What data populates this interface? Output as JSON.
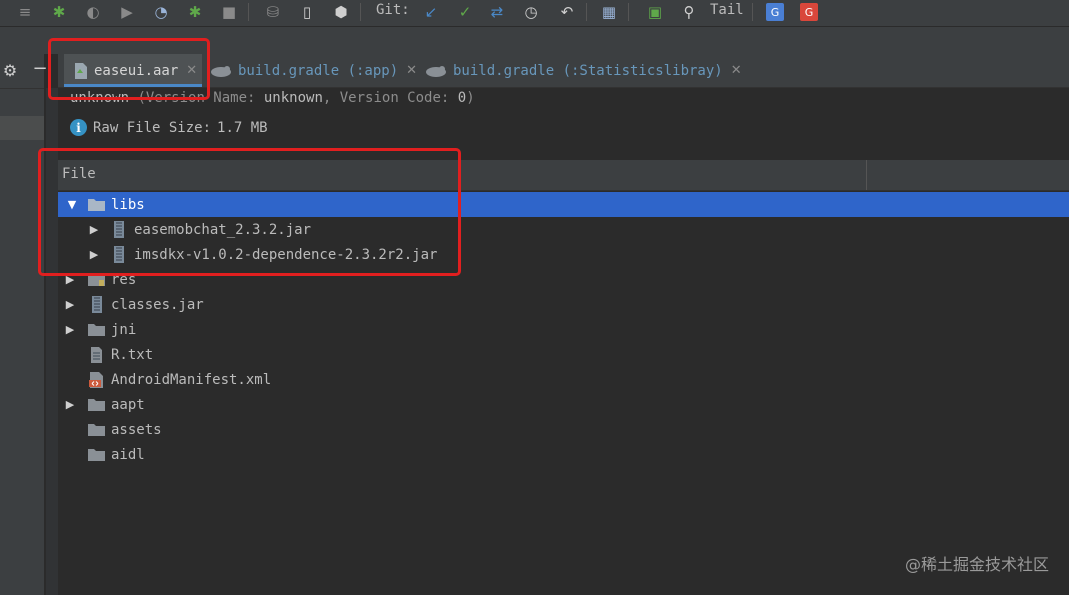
{
  "toolbar": {
    "git_label": "Git:",
    "tail_label": "Tail",
    "icons": [
      "settings-icon",
      "debug-icon",
      "profile-icon",
      "run-icon",
      "gauge-icon",
      "debug-attach-icon",
      "stop-icon",
      "gradle-icon",
      "device-icon",
      "sdk-icon",
      "update-icon",
      "commit-icon",
      "push-icon",
      "history-icon",
      "revert-icon",
      "structure-icon",
      "terminal-icon",
      "search-icon",
      "translate-icon",
      "translate-alt-icon"
    ]
  },
  "tabs": [
    {
      "label": "easeui.aar",
      "active": true
    },
    {
      "label": "build.gradle (:app)",
      "active": false
    },
    {
      "label": "build.gradle (:Statisticslibray)",
      "active": false
    }
  ],
  "info": {
    "version_line_start": "unknown",
    "version_line_dim": " (Version Name: ",
    "version_name": "unknown",
    "version_code_label": ", Version Code: ",
    "version_code": "0",
    "version_close": ")",
    "raw_size_label": "Raw File Size:",
    "raw_size_value": "1.7 MB"
  },
  "table": {
    "column_header": "File",
    "rows": [
      {
        "label": "libs",
        "type": "folder",
        "expanded": true,
        "selected": true,
        "depth": 0
      },
      {
        "label": "easemobchat_2.3.2.jar",
        "type": "jar",
        "expandable": true,
        "depth": 1
      },
      {
        "label": "imsdkx-v1.0.2-dependence-2.3.2r2.jar",
        "type": "jar",
        "expandable": true,
        "depth": 1
      },
      {
        "label": "res",
        "type": "res-folder",
        "expandable": true,
        "depth": 0
      },
      {
        "label": "classes.jar",
        "type": "jar",
        "expandable": true,
        "depth": 0
      },
      {
        "label": "jni",
        "type": "folder",
        "expandable": true,
        "depth": 0
      },
      {
        "label": "R.txt",
        "type": "text",
        "expandable": false,
        "depth": 0
      },
      {
        "label": "AndroidManifest.xml",
        "type": "xml",
        "expandable": false,
        "depth": 0
      },
      {
        "label": "aapt",
        "type": "folder",
        "expandable": true,
        "depth": 0
      },
      {
        "label": "assets",
        "type": "folder",
        "expandable": false,
        "depth": 0
      },
      {
        "label": "aidl",
        "type": "folder",
        "expandable": false,
        "depth": 0
      }
    ]
  },
  "watermark": "@稀土掘金技术社区",
  "colors": {
    "selection": "#2f65ca",
    "highlight_box": "#e11f1f",
    "tab_label": "#6897bb",
    "background": "#2b2b2b"
  }
}
